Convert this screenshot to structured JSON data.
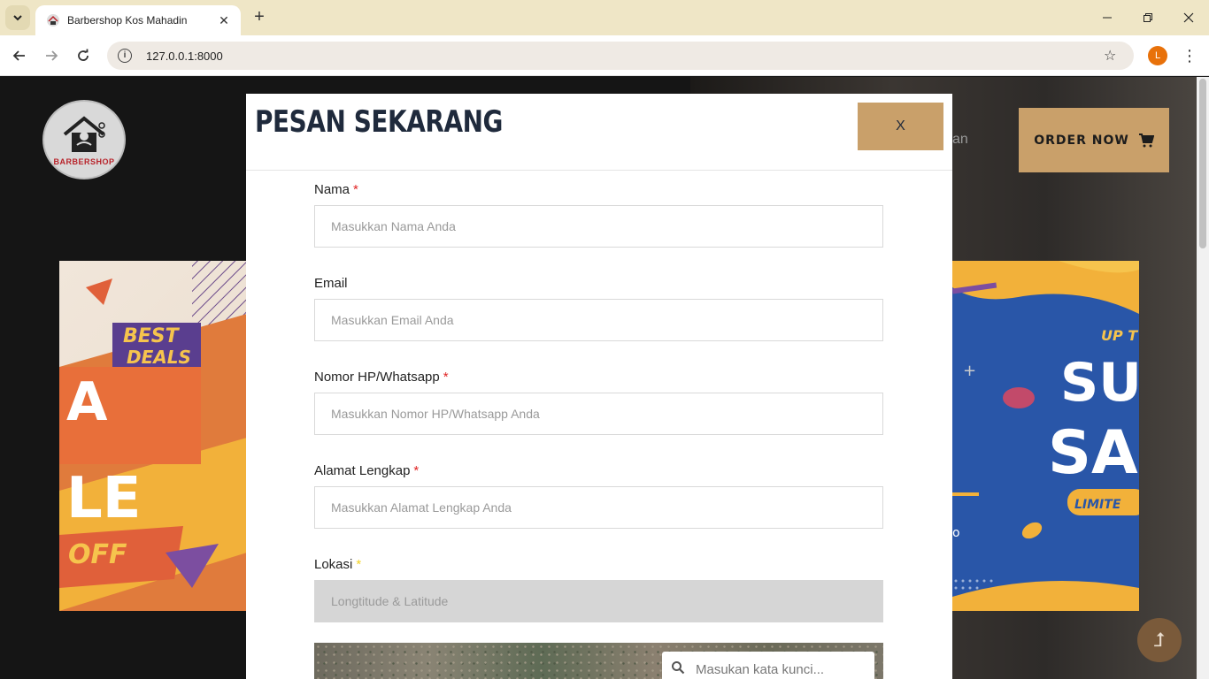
{
  "browser": {
    "tab_title": "Barbershop Kos Mahadin",
    "url": "127.0.0.1:8000",
    "profile_initial": "L"
  },
  "site": {
    "logo_text": "BARBERSHOP",
    "nav_fragment": "an",
    "order_button": "ORDER NOW"
  },
  "modal": {
    "title": "PESAN SEKARANG",
    "close_label": "X",
    "fields": {
      "nama": {
        "label": "Nama",
        "placeholder": "Masukkan Nama Anda",
        "required": "*"
      },
      "email": {
        "label": "Email",
        "placeholder": "Masukkan Email Anda"
      },
      "phone": {
        "label": "Nomor HP/Whatsapp",
        "placeholder": "Masukkan Nomor HP/Whatsapp Anda",
        "required": "*"
      },
      "alamat": {
        "label": "Alamat Lengkap",
        "placeholder": "Masukkan Alamat Lengkap Anda",
        "required": "*"
      },
      "lokasi": {
        "label": "Lokasi",
        "placeholder": "Longtitude & Latitude",
        "required": "*"
      }
    },
    "map_search_placeholder": "Masukan kata kunci..."
  },
  "colors": {
    "accent": "#c9a06a",
    "title": "#1f2a3c",
    "required": "#e02424"
  }
}
